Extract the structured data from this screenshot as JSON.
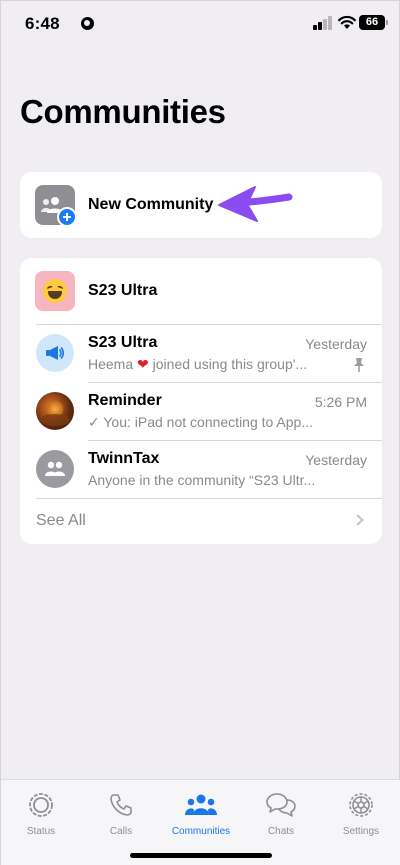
{
  "status_bar": {
    "time": "6:48",
    "battery": "66"
  },
  "page": {
    "title": "Communities"
  },
  "new_community": {
    "label": "New Community"
  },
  "community": {
    "name": "S23 Ultra",
    "chats": [
      {
        "name": "S23 Ultra",
        "time": "Yesterday",
        "preview_before": "Heema",
        "preview_after": "joined using this group'...",
        "pinned": true
      },
      {
        "name": "Reminder",
        "time": "5:26 PM",
        "preview": "✓ You: iPad not connecting to App..."
      },
      {
        "name": "TwinnTax",
        "time": "Yesterday",
        "preview": "Anyone in the community “S23 Ultr..."
      }
    ],
    "see_all": "See All"
  },
  "tab_bar": {
    "tabs": [
      {
        "label": "Status",
        "icon": "status-icon"
      },
      {
        "label": "Calls",
        "icon": "phone-icon"
      },
      {
        "label": "Communities",
        "icon": "communities-icon",
        "active": true
      },
      {
        "label": "Chats",
        "icon": "chat-bubbles-icon"
      },
      {
        "label": "Settings",
        "icon": "gear-icon"
      }
    ]
  },
  "colors": {
    "accent": "#1a78e6",
    "arrow": "#8a4cf0",
    "background": "#f0eef3"
  }
}
